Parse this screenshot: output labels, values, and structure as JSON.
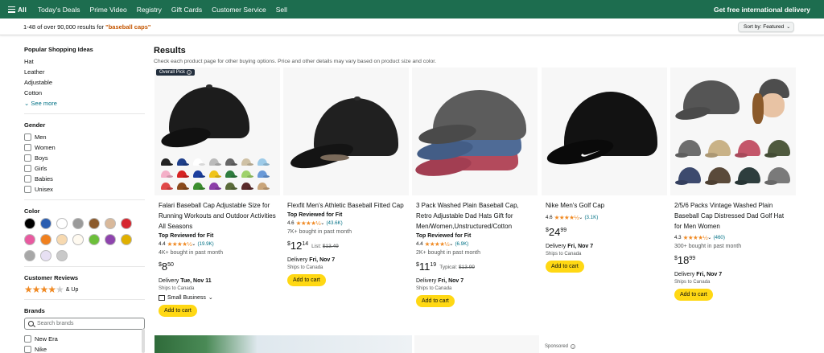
{
  "nav": {
    "all_label": "All",
    "links": [
      "Today's Deals",
      "Prime Video",
      "Registry",
      "Gift Cards",
      "Customer Service",
      "Sell"
    ],
    "intl_label": "Get free international delivery"
  },
  "results_bar": {
    "count_prefix": "1-48 of over 90,000 results for ",
    "query": "\"baseball caps\"",
    "sort_label": "Sort by:",
    "sort_value": "Featured"
  },
  "sidebar": {
    "popular": {
      "heading": "Popular Shopping Ideas",
      "items": [
        "Hat",
        "Leather",
        "Adjustable",
        "Cotton"
      ],
      "more": "See more"
    },
    "gender": {
      "heading": "Gender",
      "items": [
        "Men",
        "Women",
        "Boys",
        "Girls",
        "Babies",
        "Unisex"
      ]
    },
    "color": {
      "heading": "Color",
      "swatches": [
        "#000000",
        "#2a5db0",
        "#ffffff",
        "#9a9a9a",
        "#8b5a2b",
        "#d9b99b",
        "#d6252e",
        "#e85aa0",
        "#f0801e",
        "#f7d9b0",
        "#fffaf0",
        "#6cbf3a",
        "#8e44ad",
        "#e0b000",
        "#a7a7a7",
        "#e7e0f3",
        "#c9c9c9"
      ]
    },
    "reviews": {
      "heading": "Customer Reviews",
      "up_label": "& Up",
      "stars": 4
    },
    "brands": {
      "heading": "Brands",
      "search_placeholder": "Search brands",
      "items": [
        "New Era",
        "Nike"
      ]
    }
  },
  "results": {
    "heading": "Results",
    "subheading": "Check each product page for other buying options. Price and other details may vary based on product size and color."
  },
  "products": [
    {
      "badge": "Overall Pick",
      "title": "Falari Baseball Cap Adjustable Size for Running Workouts and Outdoor Activities All Seasons",
      "fit": "Top Reviewed for Fit",
      "rating": "4.4",
      "stars": "★★★★½",
      "count": "(19.9K)",
      "bought": "4K+ bought in past month",
      "price_whole": "8",
      "price_frac": "50",
      "price_extra": "",
      "delivery_prefix": "Delivery ",
      "delivery_date": "Tue, Nov 11",
      "ships": "Ships to Canada",
      "smallbiz": "Small Business",
      "cta": "Add to cart"
    },
    {
      "title": "Flexfit Men's Athletic Baseball Fitted Cap",
      "fit": "Top Reviewed for Fit",
      "rating": "4.6",
      "stars": "★★★★½",
      "count": "(43.6K)",
      "bought": "7K+ bought in past month",
      "price_whole": "12",
      "price_frac": "14",
      "price_list_label": "List: ",
      "price_list": "$13.49",
      "delivery_prefix": "Delivery ",
      "delivery_date": "Fri, Nov 7",
      "ships": "Ships to Canada",
      "cta": "Add to cart"
    },
    {
      "title": "3 Pack Washed Plain Baseball Cap, Retro Adjustable Dad Hats Gift for Men/Women,Unstructured/Cotton",
      "fit": "Top Reviewed for Fit",
      "rating": "4.4",
      "stars": "★★★★½",
      "count": "(6.9K)",
      "bought": "2K+ bought in past month",
      "price_whole": "11",
      "price_frac": "19",
      "price_list_label": "Typical: ",
      "price_list": "$13.99",
      "delivery_prefix": "Delivery ",
      "delivery_date": "Fri, Nov 7",
      "ships": "Ships to Canada",
      "cta": "Add to cart"
    },
    {
      "title": "Nike Men's Golf Cap",
      "rating": "4.6",
      "stars": "★★★★½",
      "count": "(3.1K)",
      "price_whole": "24",
      "price_frac": "99",
      "delivery_prefix": "Delivery ",
      "delivery_date": "Fri, Nov 7",
      "ships": "Ships to Canada",
      "cta": "Add to cart"
    },
    {
      "title": "2/5/6 Packs Vintage Washed Plain Baseball Cap Distressed Dad Golf Hat for Men Women",
      "rating": "4.3",
      "stars": "★★★★½",
      "count": "(460)",
      "bought": "300+ bought in past month",
      "price_whole": "18",
      "price_frac": "99",
      "delivery_prefix": "Delivery ",
      "delivery_date": "Fri, Nov 7",
      "ships": "Ships to Canada",
      "cta": "Add to cart"
    }
  ],
  "currency": "$",
  "sponsored_label": "Sponsored",
  "colors": {
    "nav_bg": "#1d6d4f",
    "accent_orange": "#c45500",
    "link_teal": "#007185",
    "cta_yellow": "#ffd814",
    "star_orange": "#f08a24"
  }
}
